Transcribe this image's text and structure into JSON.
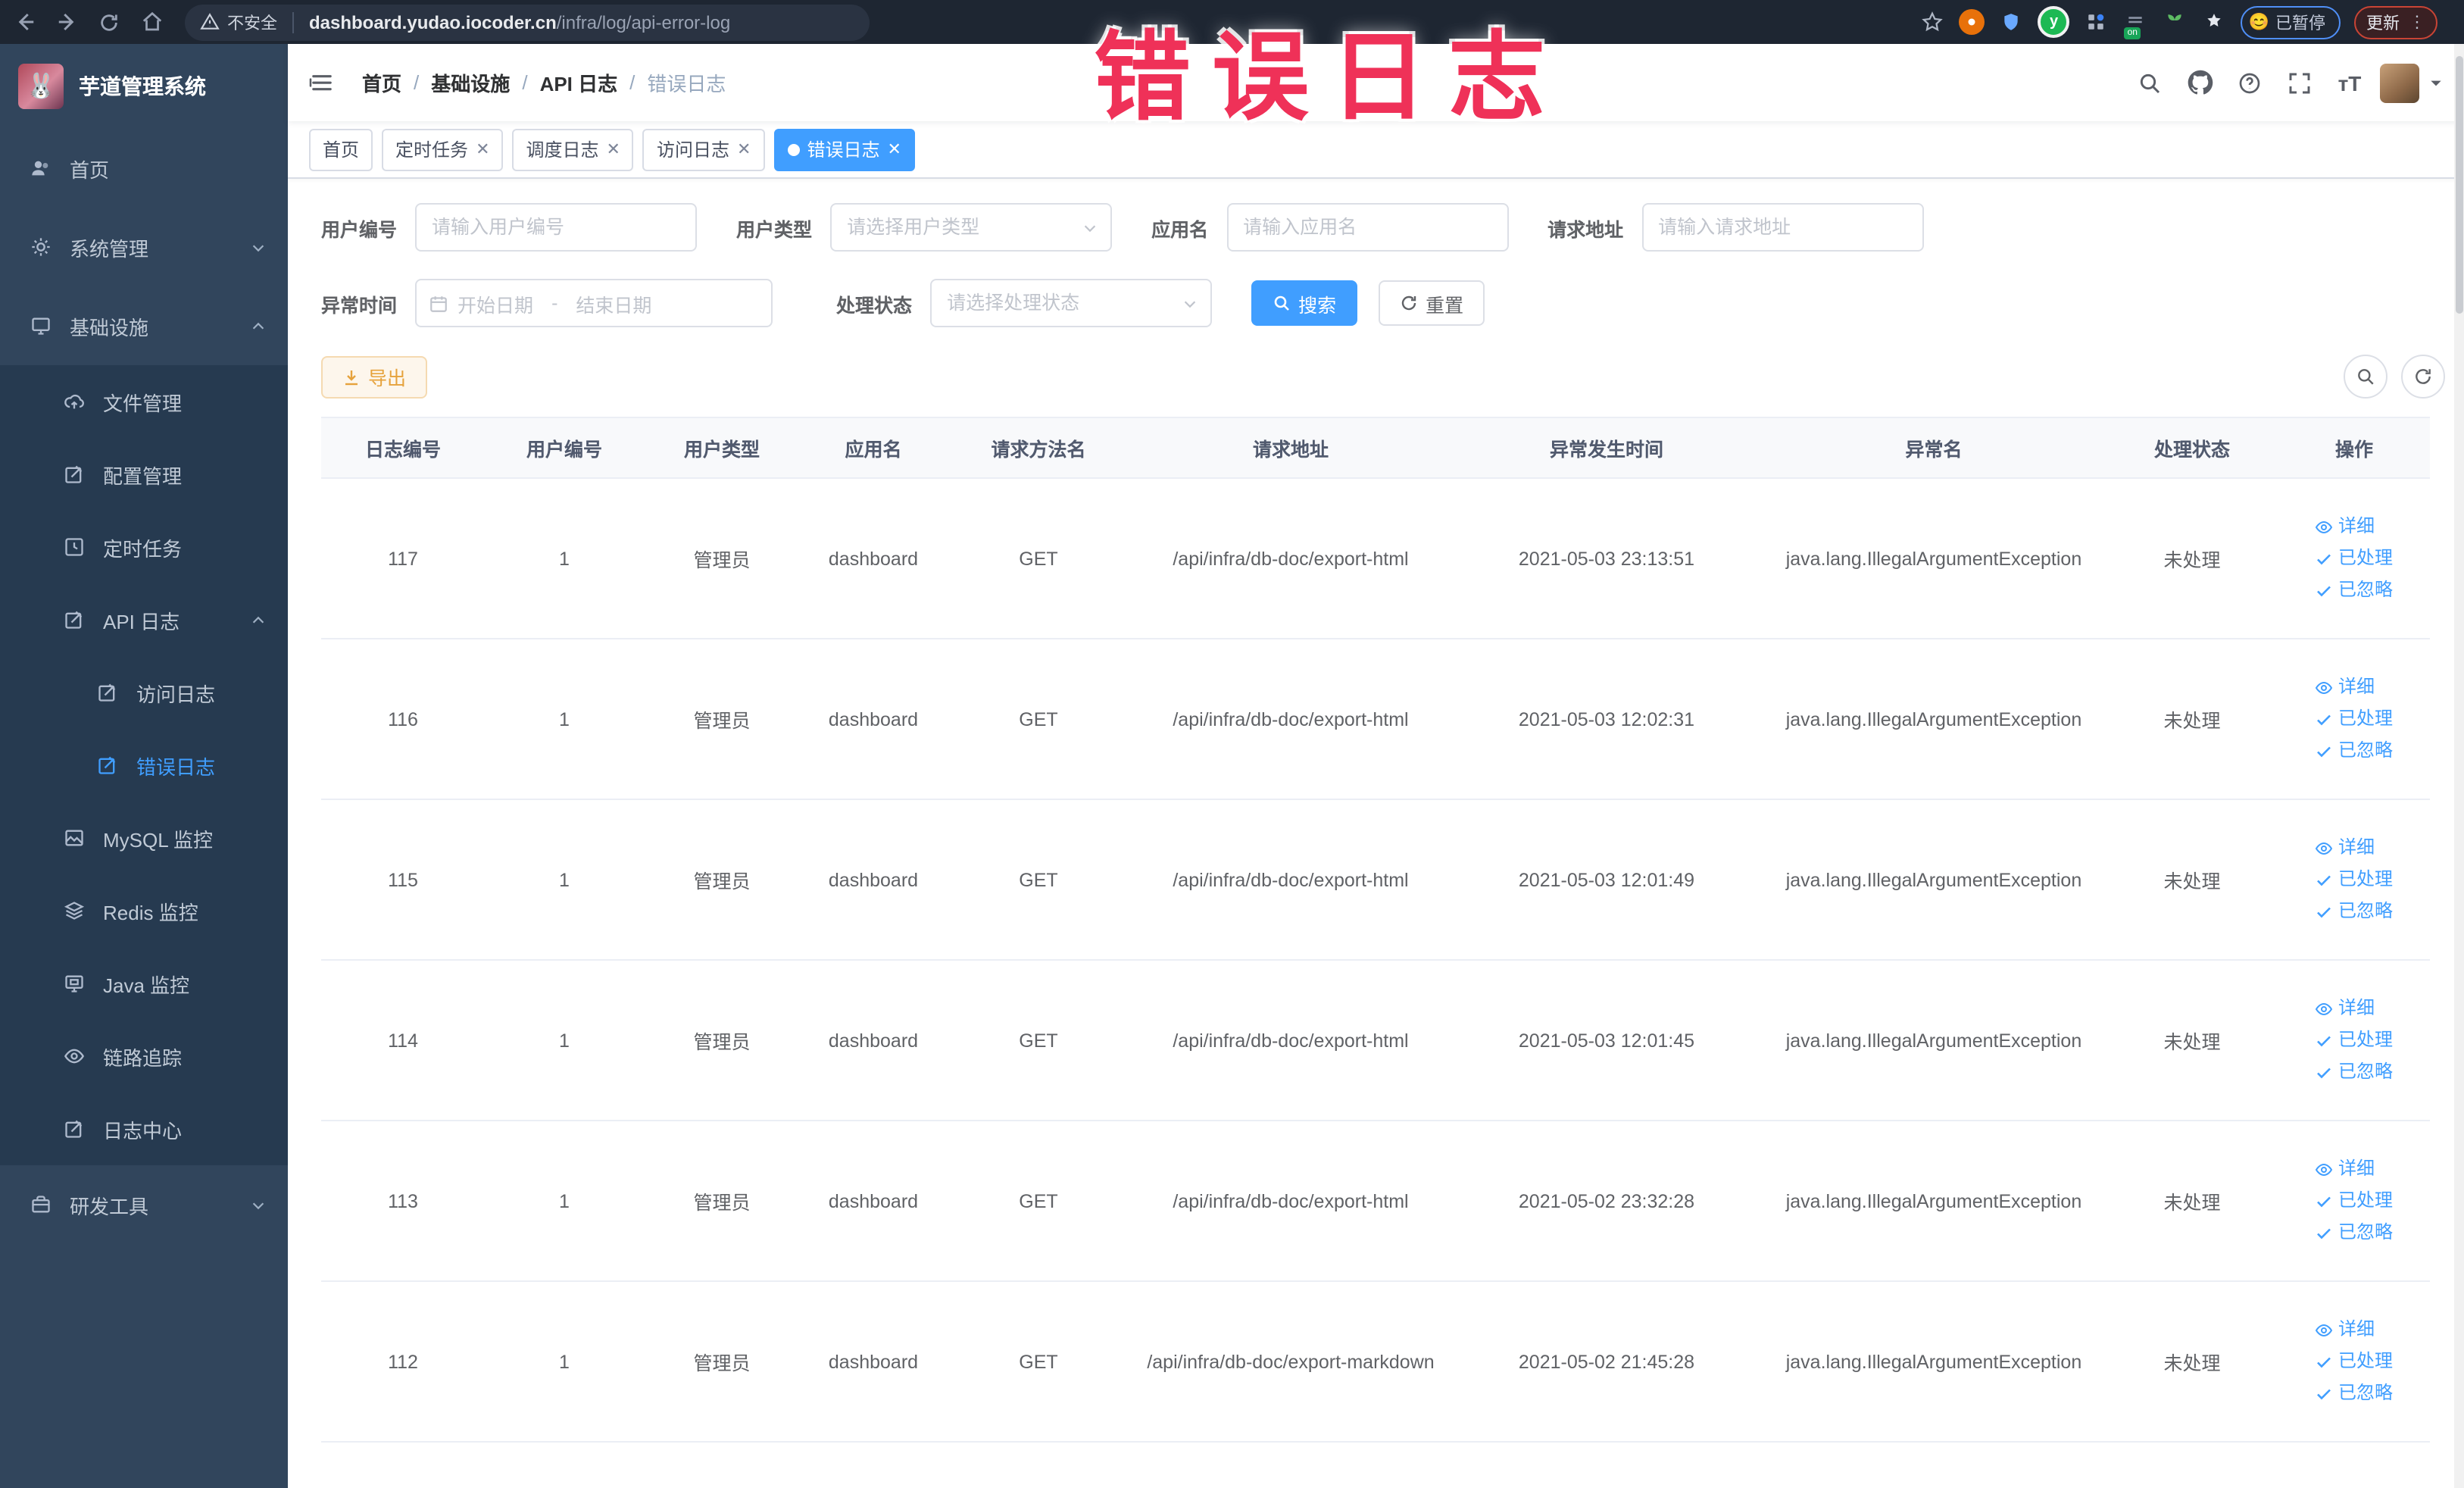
{
  "chrome": {
    "security_label": "不安全",
    "url_host": "dashboard.yudao.iocoder.cn",
    "url_path": "/infra/log/api-error-log",
    "paused_badge": "已暂停",
    "update_button": "更新",
    "paused_emoji": "😊"
  },
  "annotation": {
    "text": "错误日志",
    "color": "#ef3158"
  },
  "sidebar": {
    "title": "芋道管理系统",
    "logo_emoji": "🐰",
    "items": [
      {
        "label": "首页"
      },
      {
        "label": "系统管理"
      },
      {
        "label": "基础设施"
      },
      {
        "label": "文件管理"
      },
      {
        "label": "配置管理"
      },
      {
        "label": "定时任务"
      },
      {
        "label": "API 日志"
      },
      {
        "label": "访问日志"
      },
      {
        "label": "错误日志"
      },
      {
        "label": "MySQL 监控"
      },
      {
        "label": "Redis 监控"
      },
      {
        "label": "Java 监控"
      },
      {
        "label": "链路追踪"
      },
      {
        "label": "日志中心"
      },
      {
        "label": "研发工具"
      }
    ]
  },
  "breadcrumb": [
    "首页",
    "基础设施",
    "API 日志",
    "错误日志"
  ],
  "tabs": [
    {
      "label": "首页"
    },
    {
      "label": "定时任务"
    },
    {
      "label": "调度日志"
    },
    {
      "label": "访问日志"
    },
    {
      "label": "错误日志"
    }
  ],
  "filters": {
    "user_id_label": "用户编号",
    "user_id_placeholder": "请输入用户编号",
    "user_type_label": "用户类型",
    "user_type_placeholder": "请选择用户类型",
    "app_name_label": "应用名",
    "app_name_placeholder": "请输入应用名",
    "request_url_label": "请求地址",
    "request_url_placeholder": "请输入请求地址",
    "exception_time_label": "异常时间",
    "date_start_placeholder": "开始日期",
    "date_separator": "-",
    "date_end_placeholder": "结束日期",
    "process_status_label": "处理状态",
    "process_status_placeholder": "请选择处理状态",
    "search_button": "搜索",
    "reset_button": "重置"
  },
  "toolbar": {
    "export_button": "导出"
  },
  "table": {
    "columns": [
      "日志编号",
      "用户编号",
      "用户类型",
      "应用名",
      "请求方法名",
      "请求地址",
      "异常发生时间",
      "异常名",
      "处理状态",
      "操作"
    ],
    "row_actions": [
      "详细",
      "已处理",
      "已忽略"
    ],
    "rows": [
      {
        "id": "117",
        "user_id": "1",
        "user_type": "管理员",
        "app": "dashboard",
        "method": "GET",
        "url": "/api/infra/db-doc/export-html",
        "time": "2021-05-03 23:13:51",
        "exception": "java.lang.IllegalArgumentException",
        "status": "未处理"
      },
      {
        "id": "116",
        "user_id": "1",
        "user_type": "管理员",
        "app": "dashboard",
        "method": "GET",
        "url": "/api/infra/db-doc/export-html",
        "time": "2021-05-03 12:02:31",
        "exception": "java.lang.IllegalArgumentException",
        "status": "未处理"
      },
      {
        "id": "115",
        "user_id": "1",
        "user_type": "管理员",
        "app": "dashboard",
        "method": "GET",
        "url": "/api/infra/db-doc/export-html",
        "time": "2021-05-03 12:01:49",
        "exception": "java.lang.IllegalArgumentException",
        "status": "未处理"
      },
      {
        "id": "114",
        "user_id": "1",
        "user_type": "管理员",
        "app": "dashboard",
        "method": "GET",
        "url": "/api/infra/db-doc/export-html",
        "time": "2021-05-03 12:01:45",
        "exception": "java.lang.IllegalArgumentException",
        "status": "未处理"
      },
      {
        "id": "113",
        "user_id": "1",
        "user_type": "管理员",
        "app": "dashboard",
        "method": "GET",
        "url": "/api/infra/db-doc/export-html",
        "time": "2021-05-02 23:32:28",
        "exception": "java.lang.IllegalArgumentException",
        "status": "未处理"
      },
      {
        "id": "112",
        "user_id": "1",
        "user_type": "管理员",
        "app": "dashboard",
        "method": "GET",
        "url": "/api/infra/db-doc/export-markdown",
        "time": "2021-05-02 21:45:28",
        "exception": "java.lang.IllegalArgumentException",
        "status": "未处理"
      }
    ]
  }
}
